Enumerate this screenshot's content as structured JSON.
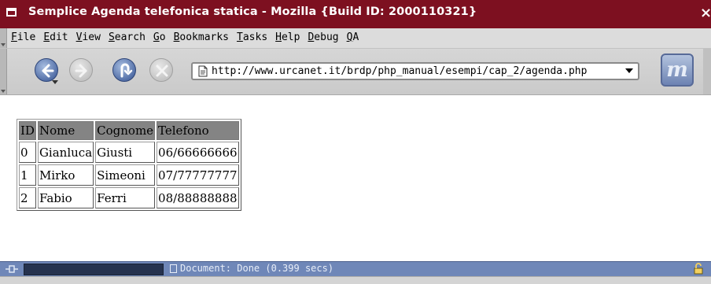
{
  "window": {
    "title": "Semplice Agenda telefonica statica - Mozilla {Build ID: 2000110321}",
    "close_glyph": "×"
  },
  "menu": {
    "items": [
      {
        "u": "F",
        "rest": "ile"
      },
      {
        "u": "E",
        "rest": "dit"
      },
      {
        "u": "V",
        "rest": "iew"
      },
      {
        "u": "S",
        "rest": "earch"
      },
      {
        "u": "G",
        "rest": "o"
      },
      {
        "u": "B",
        "rest": "ookmarks"
      },
      {
        "u": "T",
        "rest": "asks"
      },
      {
        "u": "H",
        "rest": "elp"
      },
      {
        "u": "D",
        "rest": "ebug"
      },
      {
        "u": "Q",
        "rest": "A"
      }
    ]
  },
  "toolbar": {
    "url": "http://www.urcanet.it/brdp/php_manual/esempi/cap_2/agenda.php",
    "throbber_glyph": "m"
  },
  "table": {
    "headers": [
      "ID",
      "Nome",
      "Cognome",
      "Telefono"
    ],
    "rows": [
      [
        "0",
        "Gianluca",
        "Giusti",
        "06/66666666"
      ],
      [
        "1",
        "Mirko",
        "Simeoni",
        "07/77777777"
      ],
      [
        "2",
        "Fabio",
        "Ferri",
        "08/88888888"
      ]
    ]
  },
  "status": {
    "text": "Document: Done (0.399 secs)"
  },
  "colors": {
    "titlebar": "#7d1020",
    "statusbar": "#6f87b8",
    "table_header": "#848484"
  }
}
